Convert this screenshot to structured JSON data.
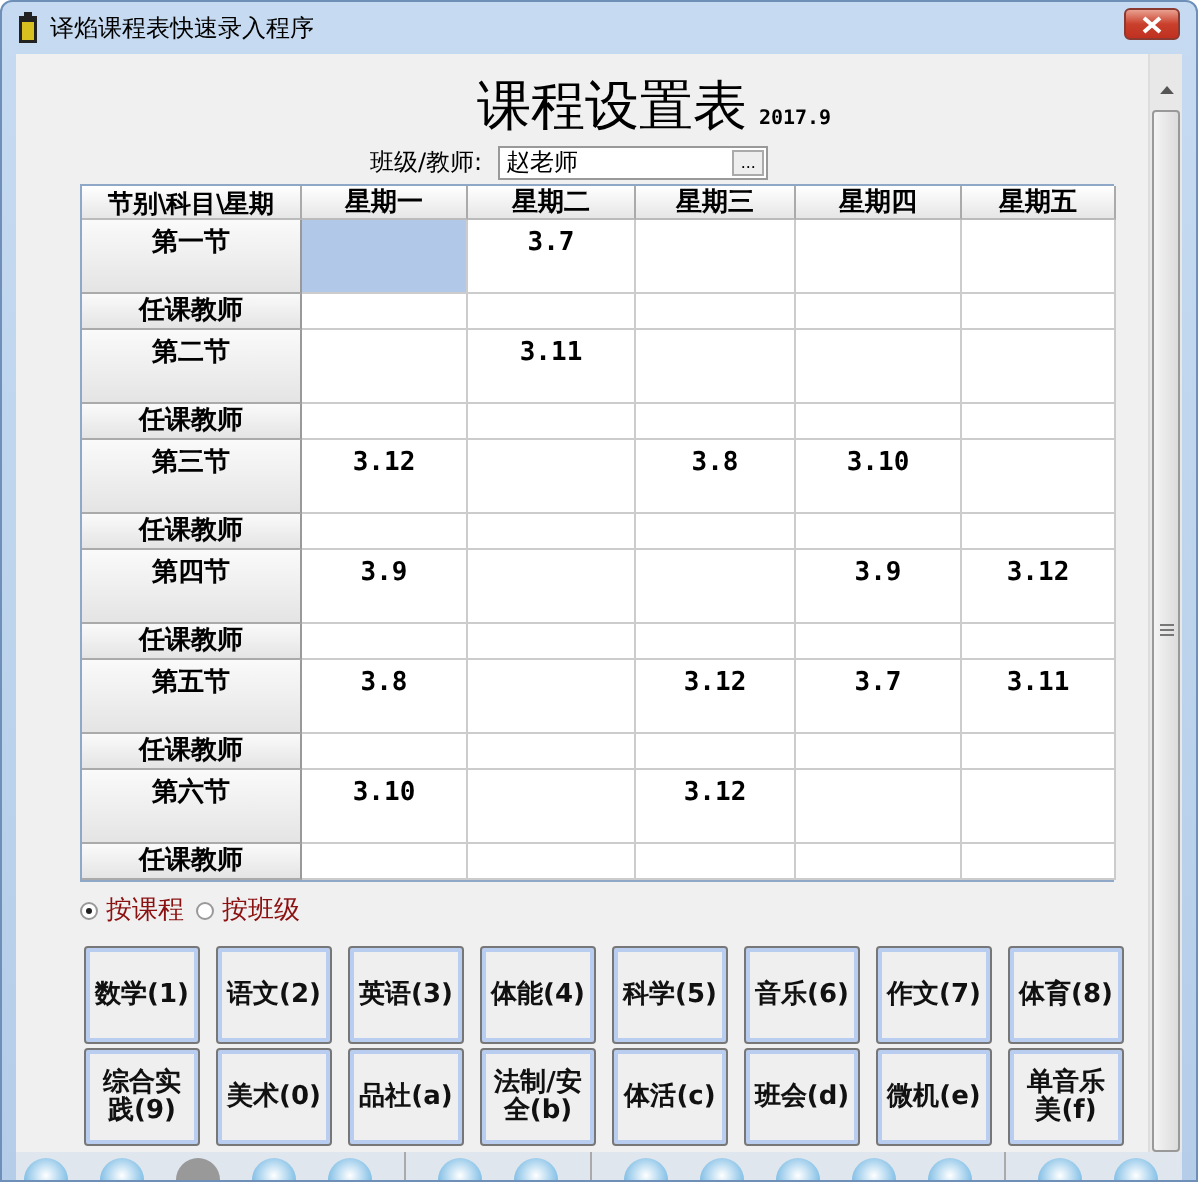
{
  "window": {
    "title": "译焰课程表快速录入程序"
  },
  "heading": {
    "title": "课程设置表",
    "date": "2017.9"
  },
  "class_teacher": {
    "label": "班级/教师:",
    "value": "赵老师",
    "browse": "..."
  },
  "table": {
    "columns": [
      "节别\\科目\\星期",
      "星期一",
      "星期二",
      "星期三",
      "星期四",
      "星期五"
    ],
    "rows": [
      {
        "kind": "period",
        "cells": [
          {
            "text": "第一节",
            "selected": false
          },
          {
            "text": "",
            "selected": true
          },
          {
            "text": "3.7",
            "selected": false
          },
          {
            "text": "",
            "selected": false
          },
          {
            "text": "",
            "selected": false
          },
          {
            "text": "",
            "selected": false
          }
        ]
      },
      {
        "kind": "teacher",
        "cells": [
          {
            "text": "任课教师",
            "selected": false
          },
          {
            "text": "",
            "selected": false
          },
          {
            "text": "",
            "selected": false
          },
          {
            "text": "",
            "selected": false
          },
          {
            "text": "",
            "selected": false
          },
          {
            "text": "",
            "selected": false
          }
        ]
      },
      {
        "kind": "period",
        "cells": [
          {
            "text": "第二节",
            "selected": false
          },
          {
            "text": "",
            "selected": false
          },
          {
            "text": "3.11",
            "selected": false
          },
          {
            "text": "",
            "selected": false
          },
          {
            "text": "",
            "selected": false
          },
          {
            "text": "",
            "selected": false
          }
        ]
      },
      {
        "kind": "teacher",
        "cells": [
          {
            "text": "任课教师",
            "selected": false
          },
          {
            "text": "",
            "selected": false
          },
          {
            "text": "",
            "selected": false
          },
          {
            "text": "",
            "selected": false
          },
          {
            "text": "",
            "selected": false
          },
          {
            "text": "",
            "selected": false
          }
        ]
      },
      {
        "kind": "period",
        "cells": [
          {
            "text": "第三节",
            "selected": false
          },
          {
            "text": "3.12",
            "selected": false
          },
          {
            "text": "",
            "selected": false
          },
          {
            "text": "3.8",
            "selected": false
          },
          {
            "text": "3.10",
            "selected": false
          },
          {
            "text": "",
            "selected": false
          }
        ]
      },
      {
        "kind": "teacher",
        "cells": [
          {
            "text": "任课教师",
            "selected": false
          },
          {
            "text": "",
            "selected": false
          },
          {
            "text": "",
            "selected": false
          },
          {
            "text": "",
            "selected": false
          },
          {
            "text": "",
            "selected": false
          },
          {
            "text": "",
            "selected": false
          }
        ]
      },
      {
        "kind": "period",
        "cells": [
          {
            "text": "第四节",
            "selected": false
          },
          {
            "text": "3.9",
            "selected": false
          },
          {
            "text": "",
            "selected": false
          },
          {
            "text": "",
            "selected": false
          },
          {
            "text": "3.9",
            "selected": false
          },
          {
            "text": "3.12",
            "selected": false
          }
        ]
      },
      {
        "kind": "teacher",
        "cells": [
          {
            "text": "任课教师",
            "selected": false
          },
          {
            "text": "",
            "selected": false
          },
          {
            "text": "",
            "selected": false
          },
          {
            "text": "",
            "selected": false
          },
          {
            "text": "",
            "selected": false
          },
          {
            "text": "",
            "selected": false
          }
        ]
      },
      {
        "kind": "period",
        "cells": [
          {
            "text": "第五节",
            "selected": false
          },
          {
            "text": "3.8",
            "selected": false
          },
          {
            "text": "",
            "selected": false
          },
          {
            "text": "3.12",
            "selected": false
          },
          {
            "text": "3.7",
            "selected": false
          },
          {
            "text": "3.11",
            "selected": false
          }
        ]
      },
      {
        "kind": "teacher",
        "cells": [
          {
            "text": "任课教师",
            "selected": false
          },
          {
            "text": "",
            "selected": false
          },
          {
            "text": "",
            "selected": false
          },
          {
            "text": "",
            "selected": false
          },
          {
            "text": "",
            "selected": false
          },
          {
            "text": "",
            "selected": false
          }
        ]
      },
      {
        "kind": "period",
        "cells": [
          {
            "text": "第六节",
            "selected": false
          },
          {
            "text": "3.10",
            "selected": false
          },
          {
            "text": "",
            "selected": false
          },
          {
            "text": "3.12",
            "selected": false
          },
          {
            "text": "",
            "selected": false
          },
          {
            "text": "",
            "selected": false
          }
        ]
      },
      {
        "kind": "teacher",
        "cells": [
          {
            "text": "任课教师",
            "selected": false
          },
          {
            "text": "",
            "selected": false
          },
          {
            "text": "",
            "selected": false
          },
          {
            "text": "",
            "selected": false
          },
          {
            "text": "",
            "selected": false
          },
          {
            "text": "",
            "selected": false
          }
        ]
      }
    ]
  },
  "mode_options": [
    {
      "label": "按课程",
      "selected": true
    },
    {
      "label": "按班级",
      "selected": false
    }
  ],
  "subject_buttons": [
    "数学(1)",
    "语文(2)",
    "英语(3)",
    "体能(4)",
    "科学(5)",
    "音乐(6)",
    "作文(7)",
    "体育(8)",
    "综合实践(9)",
    "美术(0)",
    "品社(a)",
    "法制/安全(b)",
    "体活(c)",
    "班会(d)",
    "微机(e)",
    "单音乐美(f)"
  ]
}
